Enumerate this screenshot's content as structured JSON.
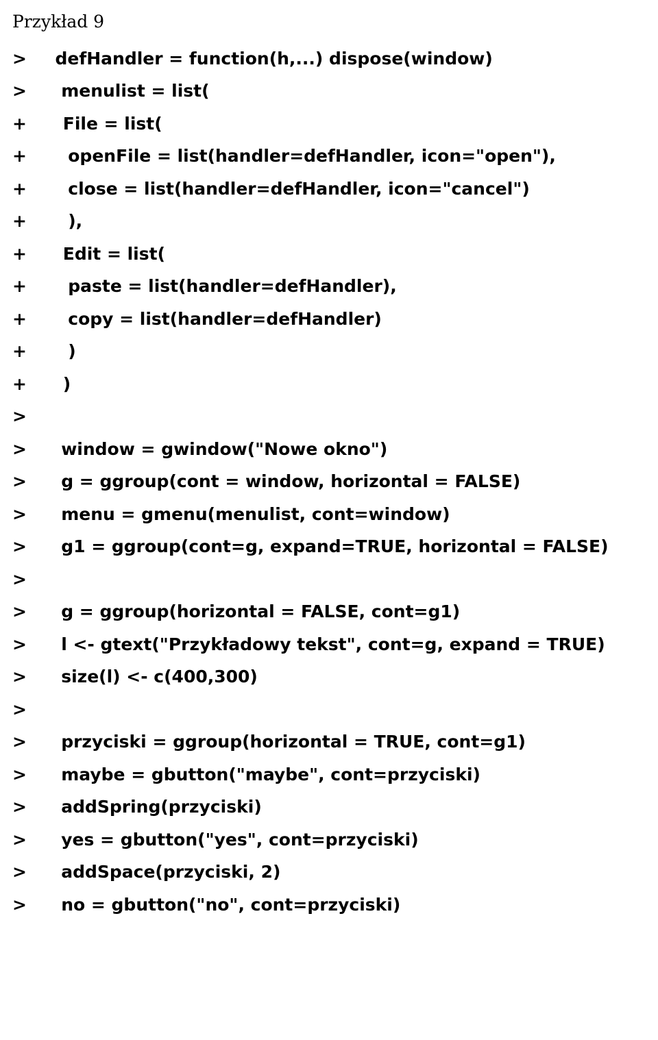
{
  "title": "Przykład 9",
  "lines": [
    {
      "gutter": ">",
      "indent": 1,
      "text": "defHandler = function(h,...) dispose(window)"
    },
    {
      "gutter": ">",
      "indent": 1,
      "text": " menulist = list("
    },
    {
      "gutter": "+",
      "indent": 2,
      "text": "File = list("
    },
    {
      "gutter": "+",
      "indent": 3,
      "text": "openFile = list(handler=defHandler, icon=\"open\"),"
    },
    {
      "gutter": "+",
      "indent": 3,
      "text": "close = list(handler=defHandler, icon=\"cancel\")"
    },
    {
      "gutter": "+",
      "indent": 3,
      "text": "),"
    },
    {
      "gutter": "+",
      "indent": 2,
      "text": "Edit = list("
    },
    {
      "gutter": "+",
      "indent": 3,
      "text": "paste = list(handler=defHandler),"
    },
    {
      "gutter": "+",
      "indent": 3,
      "text": "copy = list(handler=defHandler)"
    },
    {
      "gutter": "+",
      "indent": 3,
      "text": ")"
    },
    {
      "gutter": "+",
      "indent": 2,
      "text": ")"
    },
    {
      "gutter": ">",
      "indent": 0,
      "text": ""
    },
    {
      "gutter": ">",
      "indent": 1,
      "text": " window = gwindow(\"Nowe okno\")"
    },
    {
      "gutter": ">",
      "indent": 1,
      "text": " g = ggroup(cont = window, horizontal = FALSE)"
    },
    {
      "gutter": ">",
      "indent": 1,
      "text": " menu = gmenu(menulist, cont=window)"
    },
    {
      "gutter": ">",
      "indent": 1,
      "text": " g1 = ggroup(cont=g, expand=TRUE, horizontal = FALSE)"
    },
    {
      "gutter": ">",
      "indent": 0,
      "text": ""
    },
    {
      "gutter": ">",
      "indent": 1,
      "text": " g = ggroup(horizontal = FALSE, cont=g1)"
    },
    {
      "gutter": ">",
      "indent": 1,
      "text": " l <- gtext(\"Przykładowy tekst\", cont=g, expand = TRUE)"
    },
    {
      "gutter": ">",
      "indent": 1,
      "text": " size(l) <- c(400,300)"
    },
    {
      "gutter": ">",
      "indent": 0,
      "text": ""
    },
    {
      "gutter": ">",
      "indent": 1,
      "text": " przyciski = ggroup(horizontal = TRUE, cont=g1)"
    },
    {
      "gutter": ">",
      "indent": 1,
      "text": " maybe = gbutton(\"maybe\", cont=przyciski)"
    },
    {
      "gutter": ">",
      "indent": 1,
      "text": " addSpring(przyciski)"
    },
    {
      "gutter": ">",
      "indent": 1,
      "text": " yes = gbutton(\"yes\", cont=przyciski)"
    },
    {
      "gutter": ">",
      "indent": 1,
      "text": " addSpace(przyciski, 2)"
    },
    {
      "gutter": ">",
      "indent": 1,
      "text": " no = gbutton(\"no\", cont=przyciski)"
    }
  ]
}
